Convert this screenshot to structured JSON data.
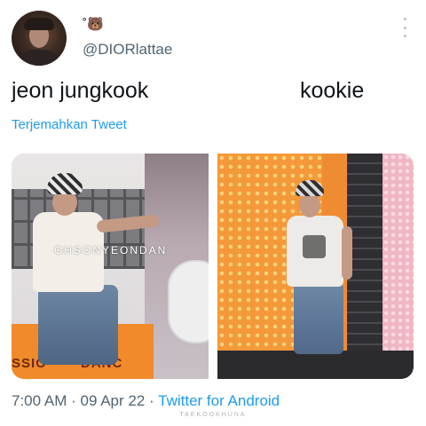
{
  "author": {
    "display_name": "˚🐻",
    "handle": "@DIORlattae"
  },
  "tweet": {
    "text_left": "jeon jungkook",
    "text_right": "kookie",
    "translate_label": "Terjemahkan Tweet"
  },
  "photos": {
    "left_watermark": "OHSONYEONDAN",
    "left_banner_text_1": "SSIO",
    "left_banner_text_2": "DANC"
  },
  "meta": {
    "time": "7:00 AM",
    "separator": "·",
    "date": "09 Apr 22",
    "source": "Twitter for Android"
  },
  "overlay": {
    "bottom_watermark": "TAEKOOKHUNA"
  },
  "colors": {
    "link": "#1d9bf0",
    "secondary_text": "#536471",
    "primary_text": "#0f1419"
  },
  "icons": [
    "more-icon"
  ]
}
